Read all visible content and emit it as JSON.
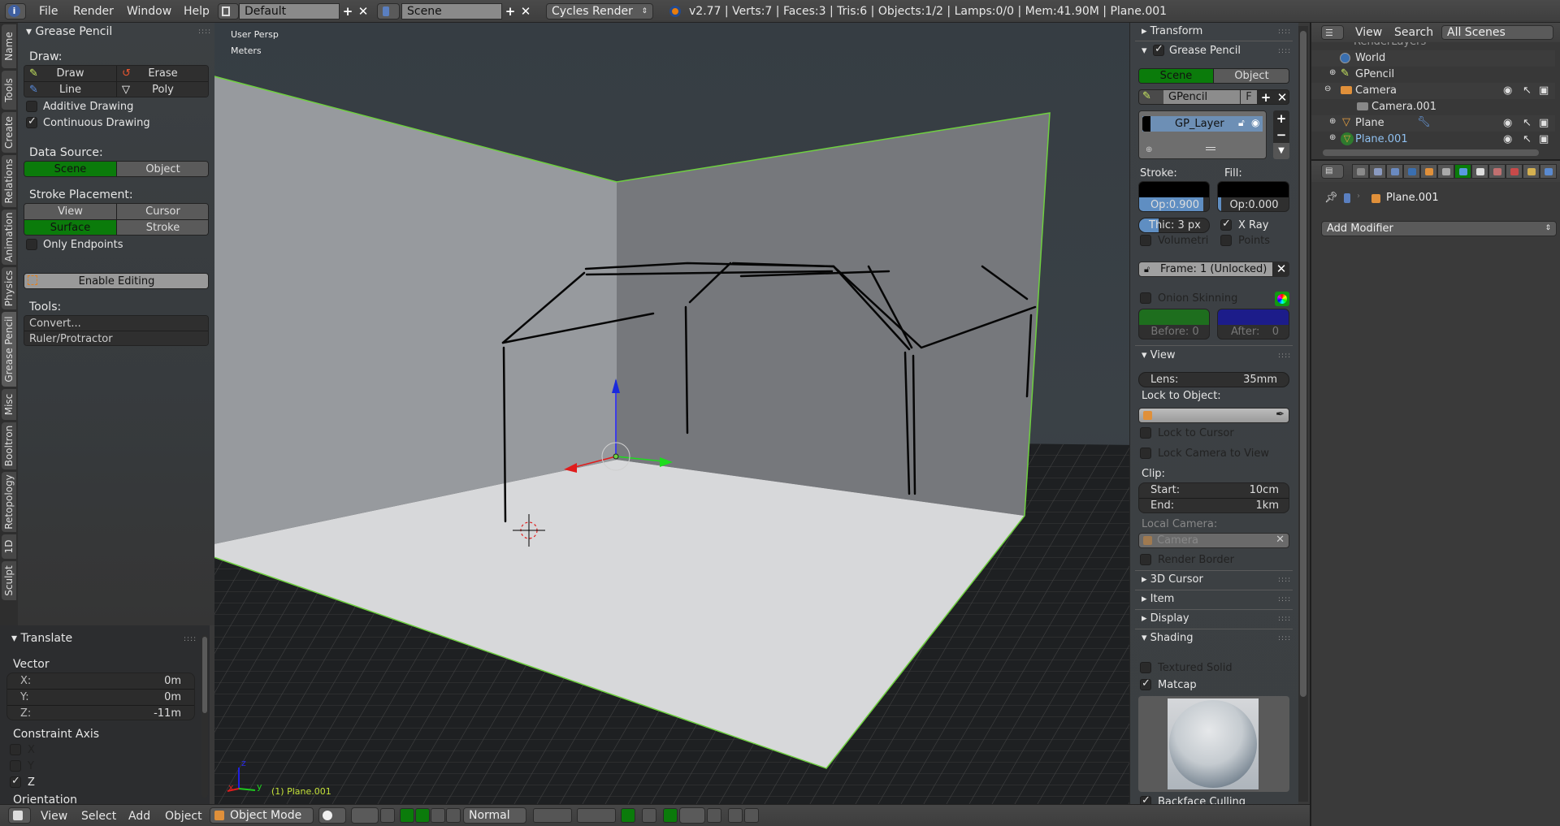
{
  "topbar": {
    "menus": [
      "File",
      "Render",
      "Window",
      "Help"
    ],
    "screen_layout": "Default",
    "scene": "Scene",
    "render_engine": "Cycles Render",
    "info": "v2.77 | Verts:7 | Faces:3 | Tris:6 | Objects:1/2 | Lamps:0/0 | Mem:41.90M | Plane.001"
  },
  "left_tabs": [
    "Name",
    "Tools",
    "Create",
    "Relations",
    "Animation",
    "Physics",
    "Grease Pencil",
    "Misc",
    "Booltron",
    "Retopology",
    "1D",
    "Sculpt"
  ],
  "active_left_tab": "Grease Pencil",
  "grease_pencil_panel": {
    "title": "Grease Pencil",
    "draw_label": "Draw:",
    "draw_buttons": [
      "Draw",
      "Erase",
      "Line",
      "Poly"
    ],
    "additive_drawing": {
      "label": "Additive Drawing",
      "checked": false
    },
    "continuous_drawing": {
      "label": "Continuous Drawing",
      "checked": true
    },
    "data_source_label": "Data Source:",
    "data_source": [
      "Scene",
      "Object"
    ],
    "data_source_active": "Scene",
    "stroke_placement_label": "Stroke Placement:",
    "stroke_placement": [
      "View",
      "Cursor",
      "Surface",
      "Stroke"
    ],
    "stroke_placement_active": "Surface",
    "only_endpoints": {
      "label": "Only Endpoints",
      "checked": false
    },
    "enable_editing": "Enable Editing",
    "tools_label": "Tools:",
    "tools": [
      "Convert...",
      "Ruler/Protractor"
    ]
  },
  "translate_panel": {
    "title": "Translate",
    "vector_label": "Vector",
    "vector": [
      {
        "axis": "X:",
        "value": "0m"
      },
      {
        "axis": "Y:",
        "value": "0m"
      },
      {
        "axis": "Z:",
        "value": "-11m"
      }
    ],
    "constraint_label": "Constraint Axis",
    "constraint": [
      {
        "axis": "X",
        "checked": false
      },
      {
        "axis": "Y",
        "checked": false
      },
      {
        "axis": "Z",
        "checked": true
      }
    ],
    "orientation_label": "Orientation"
  },
  "viewport": {
    "view_name": "User Persp",
    "units": "Meters",
    "object_info": "(1) Plane.001",
    "axis_labels": {
      "x": "x",
      "y": "y",
      "z": "z"
    }
  },
  "npanel": {
    "transform": "Transform",
    "grease_pencil": {
      "title": "Grease Pencil",
      "enabled": true,
      "source": [
        "Scene",
        "Object"
      ],
      "source_active": "Scene",
      "datablock": "GPencil",
      "fake_user": "F",
      "layer": "GP_Layer",
      "stroke_label": "Stroke:",
      "fill_label": "Fill:",
      "stroke_color": "#000000",
      "fill_color": "#000000",
      "stroke_opacity": "Op:0.900",
      "stroke_opacity_value": 0.9,
      "fill_opacity": "Op:0.000",
      "fill_opacity_value": 0.0,
      "thickness": "Thic: 3 px",
      "x_ray": {
        "label": "X Ray",
        "checked": true
      },
      "volumetric": {
        "label": "Volumetri",
        "checked": false
      },
      "points": {
        "label": "Points",
        "checked": false
      },
      "frame": "Frame: 1 (Unlocked)",
      "onion_skinning": {
        "label": "Onion Skinning",
        "checked": false
      },
      "before_color": "#1e6e1e",
      "after_color": "#1c1c8a",
      "before": "Before: 0",
      "after_label": "After:",
      "after_value": "0"
    },
    "view": {
      "title": "View",
      "lens_label": "Lens:",
      "lens_value": "35mm",
      "lock_to_object": "Lock to Object:",
      "lock_to_cursor": {
        "label": "Lock to Cursor",
        "checked": false
      },
      "lock_camera": {
        "label": "Lock Camera to View",
        "checked": false
      },
      "clip_label": "Clip:",
      "clip_start_label": "Start:",
      "clip_start": "10cm",
      "clip_end_label": "End:",
      "clip_end": "1km",
      "local_camera_label": "Local Camera:",
      "local_camera": "Camera",
      "render_border": {
        "label": "Render Border",
        "checked": false
      }
    },
    "collapsed": [
      "3D Cursor",
      "Item",
      "Display"
    ],
    "shading": {
      "title": "Shading",
      "textured_solid": {
        "label": "Textured Solid",
        "checked": false
      },
      "matcap": {
        "label": "Matcap",
        "checked": true
      },
      "backface_culling": {
        "label": "Backface Culling",
        "checked": true
      }
    }
  },
  "outliner": {
    "menus": [
      "View",
      "Search"
    ],
    "filter": "All Scenes",
    "partial_row": "RenderLayers",
    "items": [
      {
        "name": "World",
        "icon": "world-icon",
        "indent": 1
      },
      {
        "name": "GPencil",
        "icon": "pencil-icon",
        "indent": 1
      },
      {
        "name": "Camera",
        "icon": "camera-icon",
        "indent": 1
      },
      {
        "name": "Camera.001",
        "icon": "camera-data-icon",
        "indent": 2
      },
      {
        "name": "Plane",
        "icon": "mesh-icon",
        "indent": 1
      },
      {
        "name": "Plane.001",
        "icon": "mesh-icon",
        "indent": 1,
        "selected": true
      }
    ]
  },
  "properties": {
    "tabs": [
      "render",
      "render-layers",
      "scene",
      "world",
      "object",
      "constraints",
      "modifiers",
      "data",
      "material",
      "texture",
      "particles",
      "physics"
    ],
    "active_tab": "modifiers",
    "object_name": "Plane.001",
    "add_modifier": "Add Modifier"
  },
  "bottombar": {
    "menus": [
      "View",
      "Select",
      "Add",
      "Object"
    ],
    "mode": "Object Mode",
    "orientation": "Normal"
  }
}
